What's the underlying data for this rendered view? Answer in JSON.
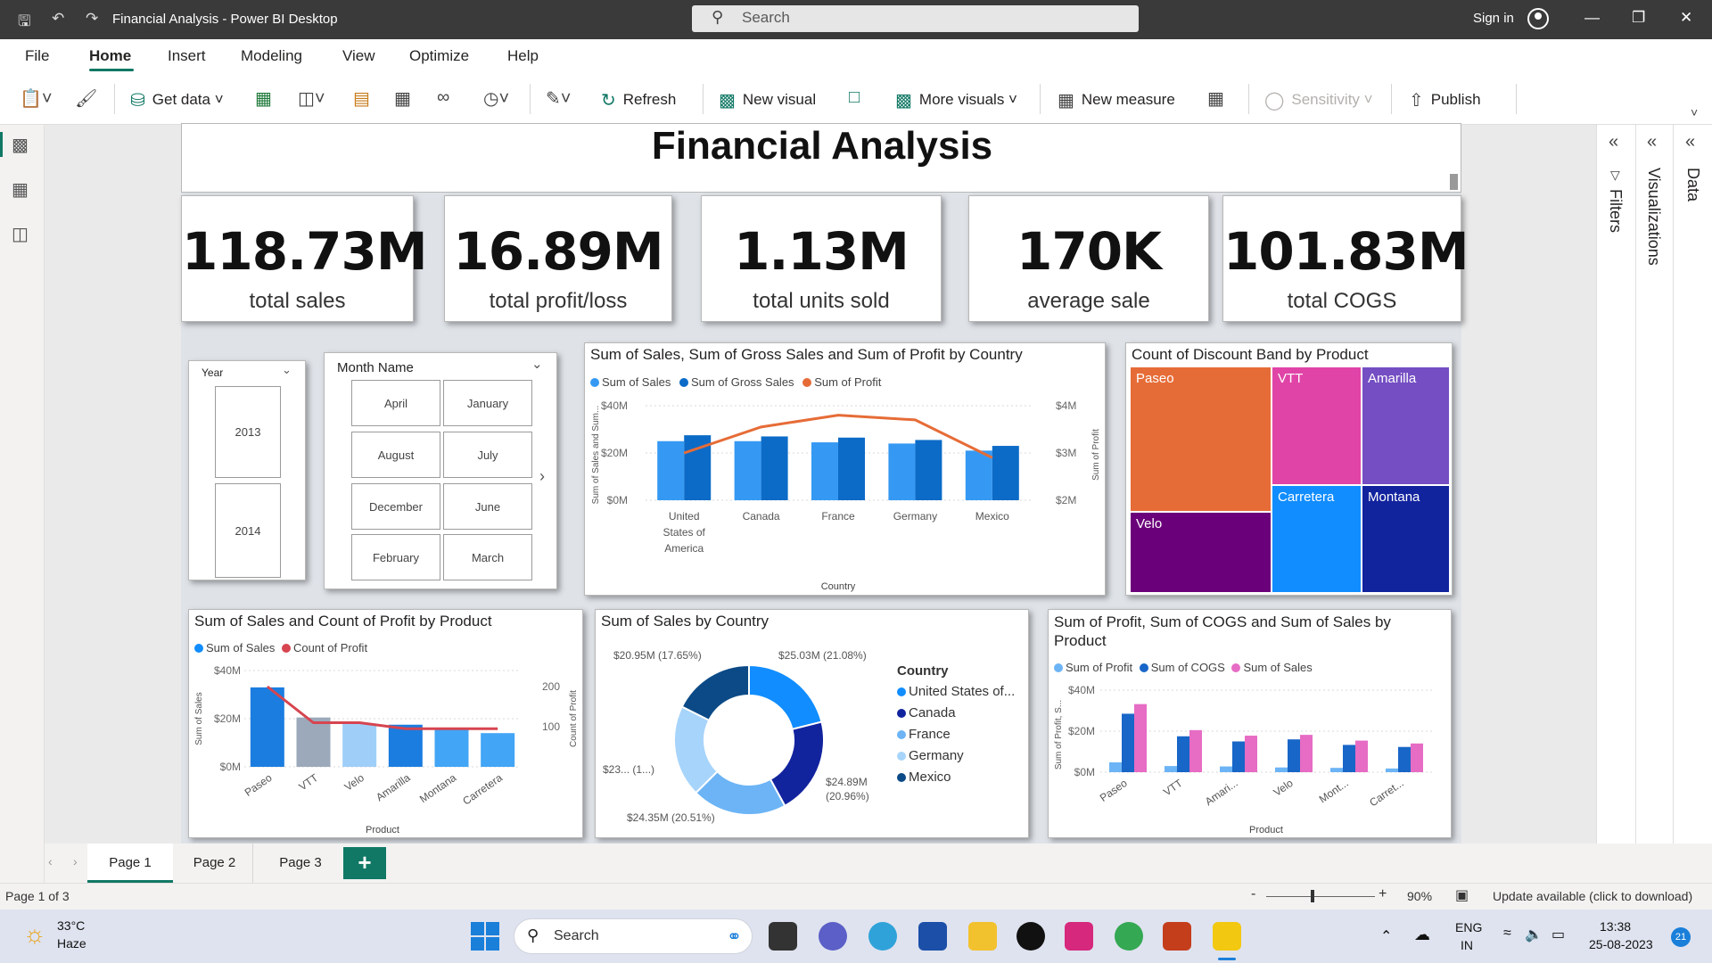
{
  "window": {
    "title": "Financial Analysis - Power BI Desktop",
    "search_placeholder": "Search",
    "sign_in": "Sign in"
  },
  "menu": {
    "file": "File",
    "home": "Home",
    "insert": "Insert",
    "modeling": "Modeling",
    "view": "View",
    "optimize": "Optimize",
    "help": "Help"
  },
  "ribbon": {
    "get_data": "Get data",
    "refresh": "Refresh",
    "new_visual": "New visual",
    "more_visuals": "More visuals",
    "new_measure": "New measure",
    "sensitivity": "Sensitivity",
    "publish": "Publish"
  },
  "report": {
    "title": "Financial Analysis",
    "kpis": [
      {
        "value": "118.73M",
        "label": "total sales"
      },
      {
        "value": "16.89M",
        "label": "total profit/loss"
      },
      {
        "value": "1.13M",
        "label": "total units sold"
      },
      {
        "value": "170K",
        "label": "average sale"
      },
      {
        "value": "101.83M",
        "label": "total COGS"
      }
    ],
    "year_slicer": {
      "header": "Year",
      "options": [
        "2013",
        "2014"
      ]
    },
    "month_slicer": {
      "header": "Month Name",
      "options": [
        "April",
        "January",
        "August",
        "July",
        "December",
        "June",
        "February",
        "March"
      ]
    }
  },
  "chart_data": [
    {
      "type": "bar",
      "title": "Sum of Sales, Sum of Gross Sales and Sum of Profit by Country",
      "xlabel": "Country",
      "ylabel": "Sum of Sales and Sum...",
      "y2label": "Sum of Profit",
      "categories": [
        "United States of America",
        "Canada",
        "France",
        "Germany",
        "Mexico"
      ],
      "category_lines": [
        [
          "United",
          "States of",
          "America"
        ],
        [
          "Canada"
        ],
        [
          "France"
        ],
        [
          "Germany"
        ],
        [
          "Mexico"
        ]
      ],
      "y_ticks": [
        "$0M",
        "$20M",
        "$40M"
      ],
      "y2_ticks": [
        "$2M",
        "$3M",
        "$4M"
      ],
      "ylim": [
        0,
        40
      ],
      "y2lim": [
        2,
        4
      ],
      "series": [
        {
          "name": "Sum of  Sales",
          "kind": "bar",
          "color": "#3599f3",
          "values": [
            25,
            25,
            24.5,
            24,
            21
          ]
        },
        {
          "name": "Sum of Gross Sales",
          "kind": "bar",
          "color": "#0c6bc7",
          "values": [
            27.5,
            27,
            26.5,
            25.5,
            23
          ]
        },
        {
          "name": "Sum of Profit",
          "kind": "line",
          "axis": "y2",
          "color": "#e66c37",
          "values": [
            3.0,
            3.55,
            3.8,
            3.7,
            2.9
          ]
        }
      ]
    },
    {
      "type": "treemap",
      "title": "Count of Discount Band by Product",
      "items": [
        {
          "name": "Paseo",
          "color": "#e66c37"
        },
        {
          "name": "VTT",
          "color": "#e044a7"
        },
        {
          "name": "Amarilla",
          "color": "#744ec2"
        },
        {
          "name": "Velo",
          "color": "#6b007b"
        },
        {
          "name": "Carretera",
          "color": "#118dff"
        },
        {
          "name": "Montana",
          "color": "#12239e"
        }
      ]
    },
    {
      "type": "bar",
      "title": "Sum of Sales and Count of Profit by Product",
      "xlabel": "Product",
      "ylabel": "Sum of Sales",
      "y2label": "Count of Profit",
      "categories": [
        "Paseo",
        "VTT",
        "Velo",
        "Amarilla",
        "Montana",
        "Carretera"
      ],
      "y_ticks": [
        "$0M",
        "$20M",
        "$40M"
      ],
      "y2_ticks": [
        "100",
        "200"
      ],
      "ylim": [
        0,
        40
      ],
      "y2lim": [
        0,
        240
      ],
      "series": [
        {
          "name": "Sum of  Sales",
          "kind": "bar",
          "color": "#118dff",
          "values": [
            33,
            20.5,
            18,
            17.5,
            15.5,
            14
          ]
        },
        {
          "name": "Count of Profit",
          "kind": "line",
          "axis": "y2",
          "color": "#d64550",
          "values": [
            200,
            110,
            110,
            95,
            95,
            95
          ]
        }
      ],
      "bar_colors": [
        "#1b7de0",
        "#9ba9ba",
        "#9fcff8",
        "#1b7de0",
        "#42a5f5",
        "#42a5f5"
      ]
    },
    {
      "type": "pie",
      "title": "Sum of Sales by Country",
      "legend_title": "Country",
      "slices": [
        {
          "name": "United States of...",
          "label": "$25.03M (21.08%)",
          "value": 25.03,
          "color": "#118dff"
        },
        {
          "name": "Canada",
          "label": "$24.89M (20.96%)",
          "value": 24.89,
          "color": "#12239e"
        },
        {
          "name": "France",
          "label": "$24.35M (20.51%)",
          "value": 24.35,
          "color": "#6cb4f5"
        },
        {
          "name": "Germany",
          "label": "$23... (1...)",
          "value": 23.5,
          "color": "#a7d4fb"
        },
        {
          "name": "Mexico",
          "label": "$20.95M (17.65%)",
          "value": 20.95,
          "color": "#0b4a86"
        }
      ]
    },
    {
      "type": "bar",
      "title": "Sum of Profit, Sum of COGS and Sum of Sales by Product",
      "xlabel": "Product",
      "ylabel": "Sum of Profit, S...",
      "categories": [
        "Paseo",
        "VTT",
        "Amari...",
        "Velo",
        "Mont...",
        "Carret..."
      ],
      "y_ticks": [
        "$0M",
        "$20M",
        "$40M"
      ],
      "ylim": [
        0,
        40
      ],
      "series": [
        {
          "name": "Sum of Profit",
          "color": "#6cb4f5",
          "values": [
            4.8,
            3.0,
            2.8,
            2.3,
            2.1,
            1.8
          ]
        },
        {
          "name": "Sum of COGS",
          "color": "#1866c7",
          "values": [
            28.5,
            17.5,
            15,
            16,
            13.3,
            12.3
          ]
        },
        {
          "name": "Sum of  Sales",
          "color": "#e66cc4",
          "values": [
            33.2,
            20.5,
            17.8,
            18.2,
            15.4,
            14.0
          ]
        }
      ]
    }
  ],
  "panes": {
    "filters": "Filters",
    "visualizations": "Visualizations",
    "data": "Data"
  },
  "pages": {
    "tabs": [
      "Page 1",
      "Page 2",
      "Page 3"
    ],
    "add": "+"
  },
  "status": {
    "page_info": "Page 1 of 3",
    "zoom": "90%",
    "update": "Update available (click to download)"
  },
  "taskbar": {
    "temp": "33°C",
    "weather": "Haze",
    "search": "Search",
    "lang1": "ENG",
    "lang2": "IN",
    "time": "13:38",
    "date": "25-08-2023",
    "notif": "21"
  },
  "colors": {
    "accent": "#117865",
    "titlebar": "#3a3a3a"
  }
}
